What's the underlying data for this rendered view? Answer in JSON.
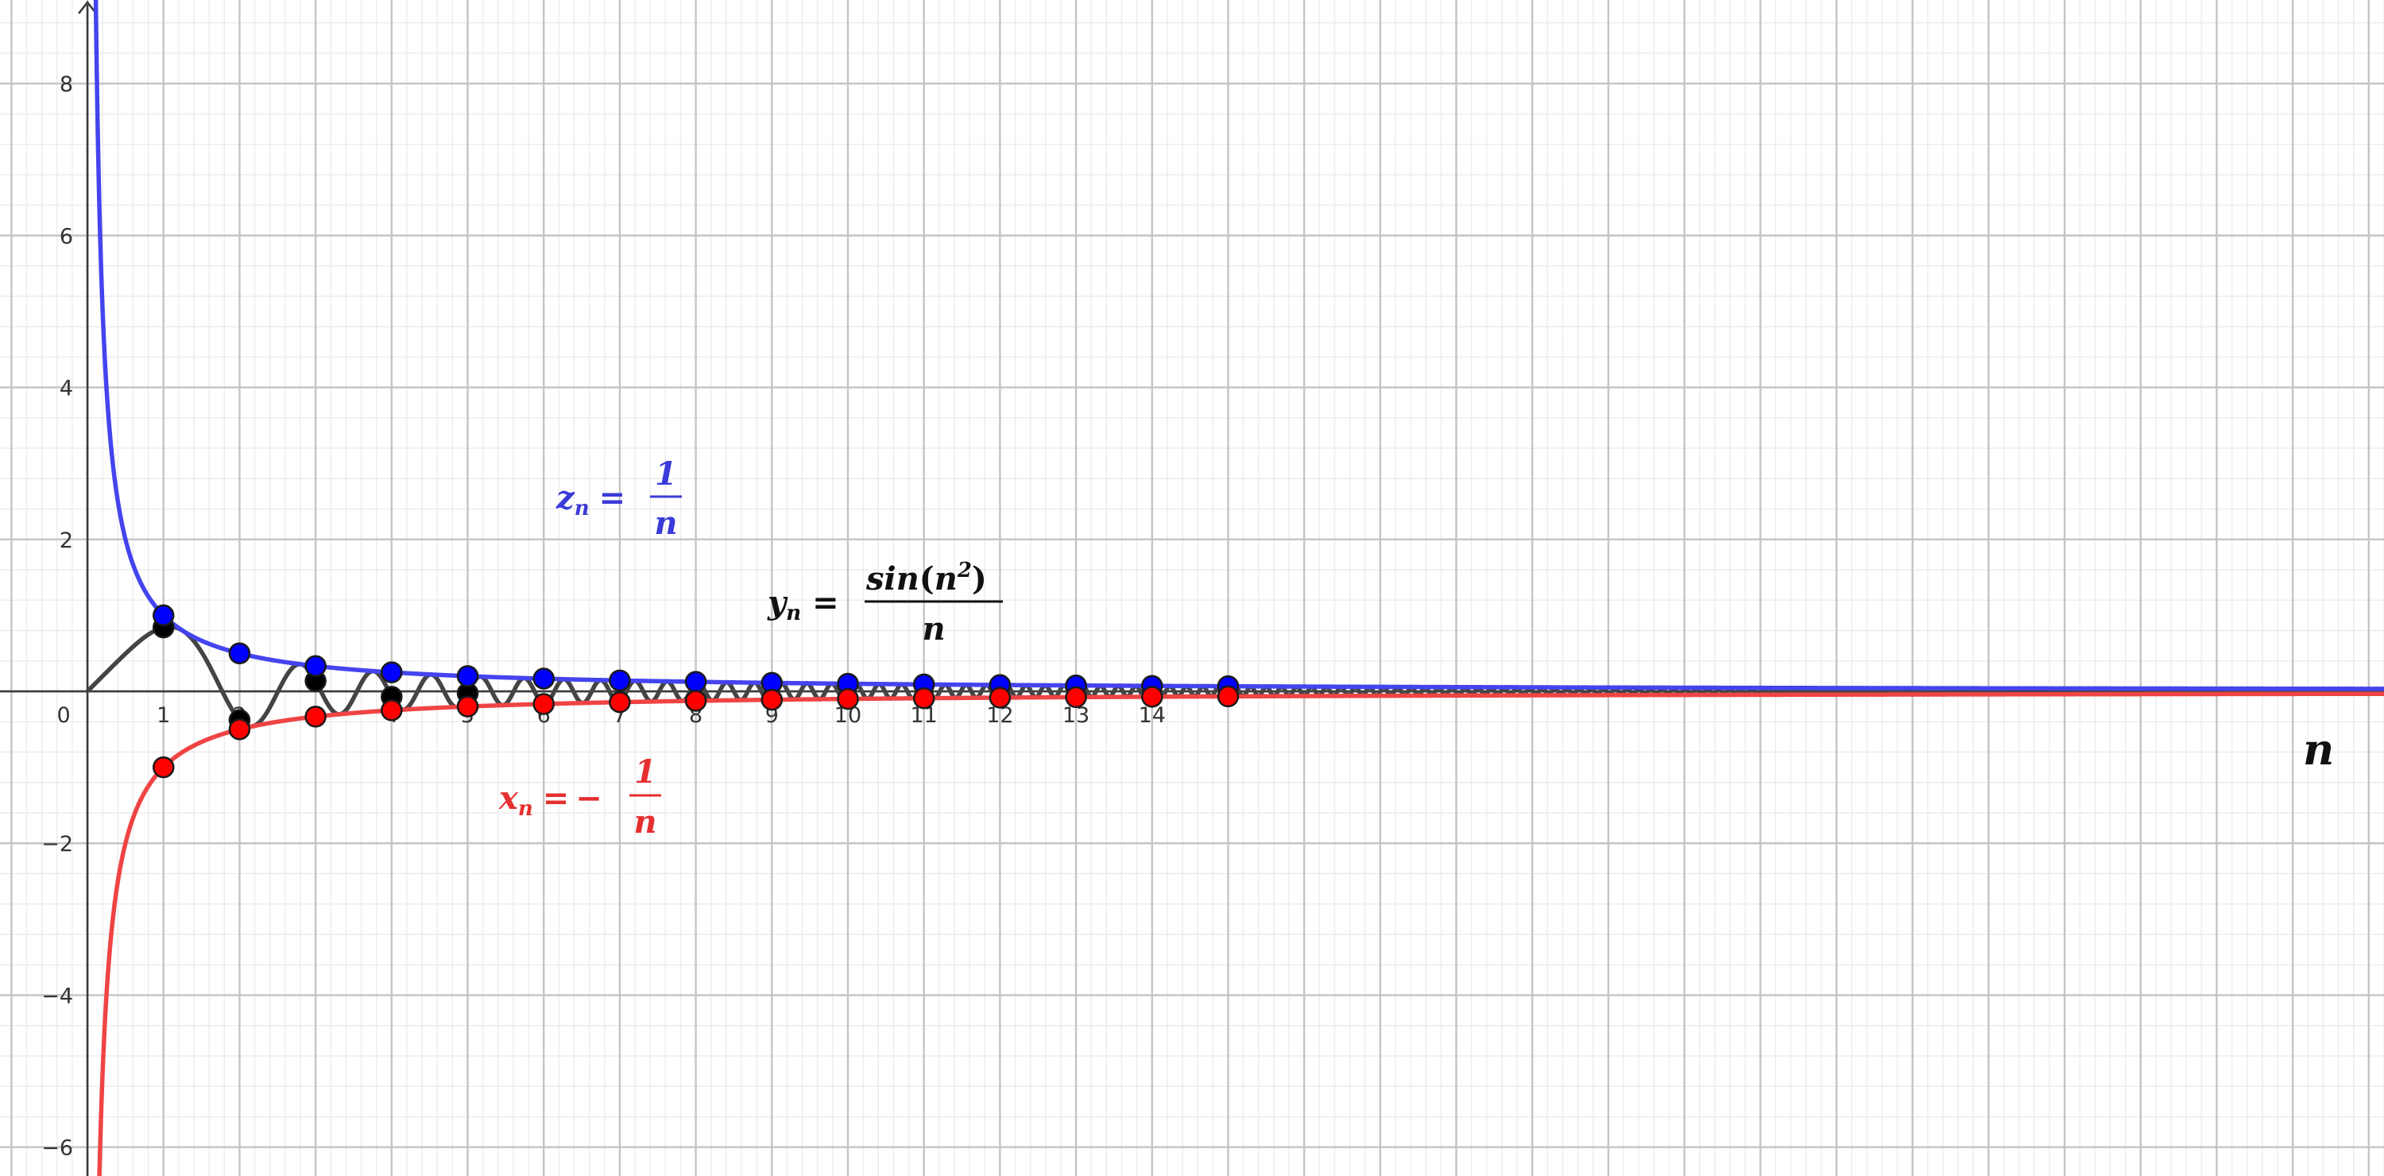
{
  "chart_data": {
    "type": "line",
    "title": "",
    "xlabel": "n",
    "ylabel": "",
    "xlim": [
      -1.15,
      30.2
    ],
    "ylim": [
      -6.38,
      9.1
    ],
    "grid": true,
    "x_ticks": [
      {
        "v": 0,
        "label": "0"
      },
      {
        "v": 1,
        "label": "1"
      },
      {
        "v": 2,
        "label": "2"
      },
      {
        "v": 3,
        "label": "3"
      },
      {
        "v": 4,
        "label": "4"
      },
      {
        "v": 5,
        "label": "5"
      },
      {
        "v": 6,
        "label": "6"
      },
      {
        "v": 7,
        "label": "7"
      },
      {
        "v": 8,
        "label": "8"
      },
      {
        "v": 9,
        "label": "9"
      },
      {
        "v": 10,
        "label": "10"
      },
      {
        "v": 11,
        "label": "11"
      },
      {
        "v": 12,
        "label": "12"
      },
      {
        "v": 13,
        "label": "13"
      },
      {
        "v": 14,
        "label": "14"
      }
    ],
    "y_ticks": [
      {
        "v": 8,
        "label": "8"
      },
      {
        "v": 6,
        "label": "6"
      },
      {
        "v": 4,
        "label": "4"
      },
      {
        "v": 2,
        "label": "2"
      },
      {
        "v": -2,
        "label": "−2"
      },
      {
        "v": -4,
        "label": "−4"
      },
      {
        "v": -6,
        "label": "−6"
      }
    ],
    "series": [
      {
        "name": "z_n",
        "color": "#4444ee",
        "point_color": "#0000ff",
        "formula": "1/n",
        "x": [
          1,
          2,
          3,
          4,
          5,
          6,
          7,
          8,
          9,
          10,
          11,
          12,
          13,
          14,
          15
        ],
        "values": [
          1.0,
          0.5,
          0.333,
          0.25,
          0.2,
          0.167,
          0.143,
          0.125,
          0.111,
          0.1,
          0.091,
          0.083,
          0.077,
          0.071,
          0.067
        ]
      },
      {
        "name": "y_n",
        "color": "#444444",
        "point_color": "#000000",
        "formula": "sin(n^2)/n",
        "x": [
          1,
          2,
          3,
          4,
          5
        ],
        "values": [
          0.841,
          -0.378,
          0.137,
          -0.072,
          -0.026
        ]
      },
      {
        "name": "x_n",
        "color": "#ef4444",
        "point_color": "#ff0000",
        "formula": "-1/n",
        "x": [
          1,
          2,
          3,
          4,
          5,
          6,
          7,
          8,
          9,
          10,
          11,
          12,
          13,
          14,
          15
        ],
        "values": [
          -1.0,
          -0.5,
          -0.333,
          -0.25,
          -0.2,
          -0.167,
          -0.143,
          -0.125,
          -0.111,
          -0.1,
          -0.091,
          -0.083,
          -0.077,
          -0.071,
          -0.067
        ]
      }
    ],
    "labels": {
      "z": {
        "var": "z",
        "sub": "n",
        "eq": "=",
        "num": "1",
        "den": "n"
      },
      "y": {
        "var": "y",
        "sub": "n",
        "eq": "=",
        "num_fn": "sin",
        "num_base": "n",
        "num_exp": "2",
        "den": "n"
      },
      "x": {
        "var": "x",
        "sub": "n",
        "eq": "=",
        "minus": "−",
        "num": "1",
        "den": "n"
      }
    }
  }
}
